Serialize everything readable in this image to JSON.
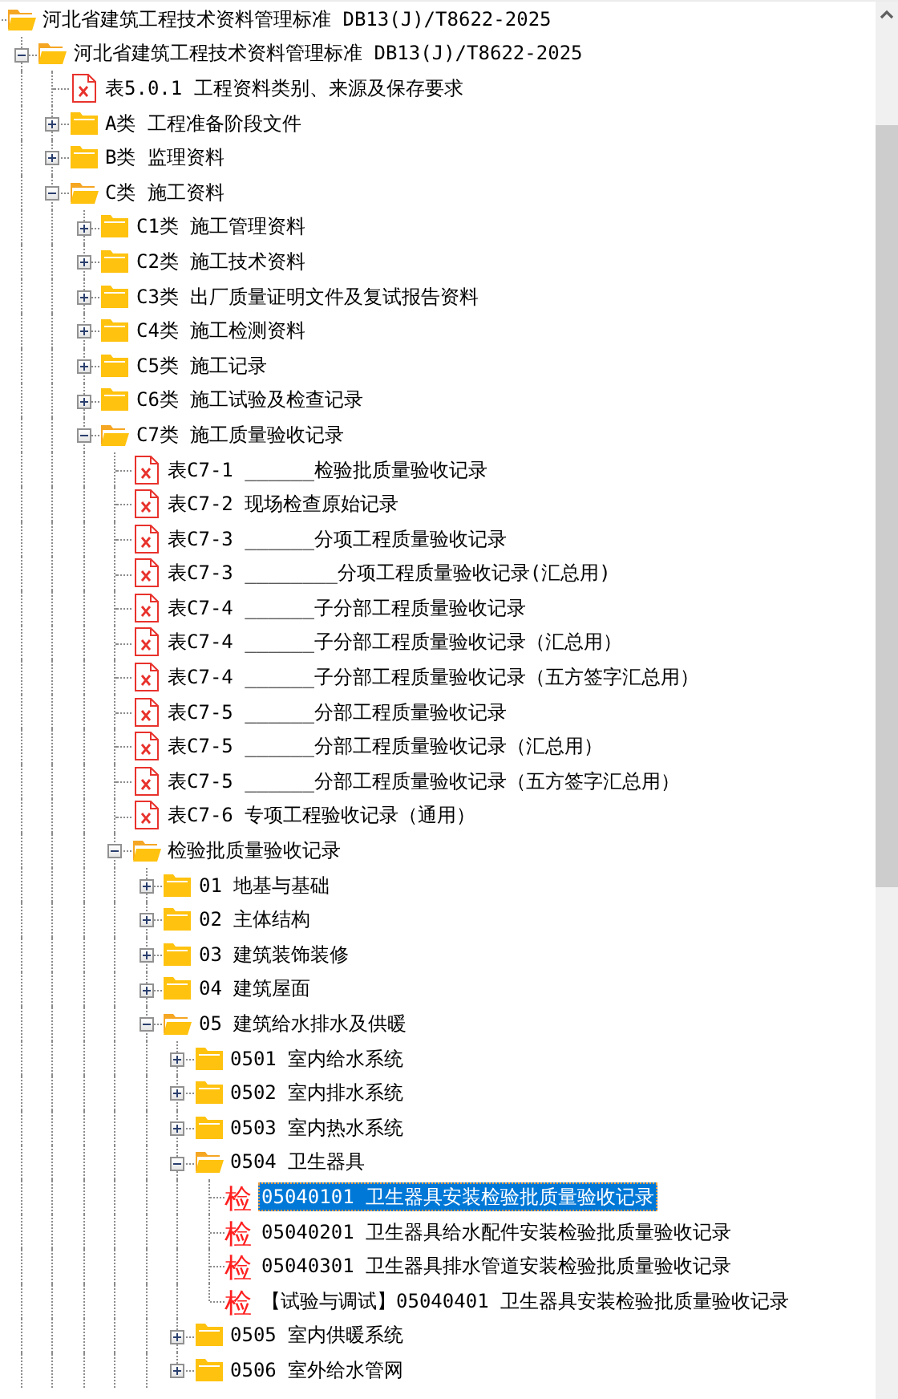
{
  "tree": {
    "label": "河北省建筑工程技术资料管理标准 DB13(J)/T8622-2025",
    "kind": "folder",
    "expanded": true,
    "selected": false,
    "children": [
      {
        "label": "河北省建筑工程技术资料管理标准 DB13(J)/T8622-2025",
        "kind": "folder",
        "expanded": true,
        "selected": false,
        "continues": true,
        "children": [
          {
            "label": "表5.0.1 工程资料类别、来源及保存要求",
            "kind": "file",
            "selected": false
          },
          {
            "label": "A类 工程准备阶段文件",
            "kind": "folder",
            "expanded": false,
            "selected": false
          },
          {
            "label": "B类 监理资料",
            "kind": "folder",
            "expanded": false,
            "selected": false
          },
          {
            "label": "C类 施工资料",
            "kind": "folder",
            "expanded": true,
            "selected": false,
            "continues": true,
            "children": [
              {
                "label": "C1类 施工管理资料",
                "kind": "folder",
                "expanded": false,
                "selected": false
              },
              {
                "label": "C2类 施工技术资料",
                "kind": "folder",
                "expanded": false,
                "selected": false
              },
              {
                "label": "C3类 出厂质量证明文件及复试报告资料",
                "kind": "folder",
                "expanded": false,
                "selected": false
              },
              {
                "label": "C4类 施工检测资料",
                "kind": "folder",
                "expanded": false,
                "selected": false
              },
              {
                "label": "C5类 施工记录",
                "kind": "folder",
                "expanded": false,
                "selected": false
              },
              {
                "label": "C6类 施工试验及检查记录",
                "kind": "folder",
                "expanded": false,
                "selected": false
              },
              {
                "label": "C7类 施工质量验收记录",
                "kind": "folder",
                "expanded": true,
                "selected": false,
                "continues": true,
                "children": [
                  {
                    "label": "表C7-1 ______检验批质量验收记录",
                    "kind": "file",
                    "selected": false
                  },
                  {
                    "label": "表C7-2 现场检查原始记录",
                    "kind": "file",
                    "selected": false
                  },
                  {
                    "label": "表C7-3 ______分项工程质量验收记录",
                    "kind": "file",
                    "selected": false
                  },
                  {
                    "label": "表C7-3 ________分项工程质量验收记录(汇总用)",
                    "kind": "file",
                    "selected": false
                  },
                  {
                    "label": "表C7-4 ______子分部工程质量验收记录",
                    "kind": "file",
                    "selected": false
                  },
                  {
                    "label": "表C7-4 ______子分部工程质量验收记录（汇总用）",
                    "kind": "file",
                    "selected": false
                  },
                  {
                    "label": "表C7-4 ______子分部工程质量验收记录（五方签字汇总用）",
                    "kind": "file",
                    "selected": false
                  },
                  {
                    "label": "表C7-5 ______分部工程质量验收记录",
                    "kind": "file",
                    "selected": false
                  },
                  {
                    "label": "表C7-5 ______分部工程质量验收记录（汇总用）",
                    "kind": "file",
                    "selected": false
                  },
                  {
                    "label": "表C7-5 ______分部工程质量验收记录（五方签字汇总用）",
                    "kind": "file",
                    "selected": false
                  },
                  {
                    "label": "表C7-6 专项工程验收记录（通用）",
                    "kind": "file",
                    "selected": false
                  },
                  {
                    "label": "检验批质量验收记录",
                    "kind": "folder",
                    "expanded": true,
                    "selected": false,
                    "continues": true,
                    "children": [
                      {
                        "label": "01 地基与基础",
                        "kind": "folder",
                        "expanded": false,
                        "selected": false
                      },
                      {
                        "label": "02 主体结构",
                        "kind": "folder",
                        "expanded": false,
                        "selected": false
                      },
                      {
                        "label": "03 建筑装饰装修",
                        "kind": "folder",
                        "expanded": false,
                        "selected": false
                      },
                      {
                        "label": "04 建筑屋面",
                        "kind": "folder",
                        "expanded": false,
                        "selected": false
                      },
                      {
                        "label": "05 建筑给水排水及供暖",
                        "kind": "folder",
                        "expanded": true,
                        "selected": false,
                        "continues": true,
                        "children": [
                          {
                            "label": "0501 室内给水系统",
                            "kind": "folder",
                            "expanded": false,
                            "selected": false
                          },
                          {
                            "label": "0502 室内排水系统",
                            "kind": "folder",
                            "expanded": false,
                            "selected": false
                          },
                          {
                            "label": "0503 室内热水系统",
                            "kind": "folder",
                            "expanded": false,
                            "selected": false
                          },
                          {
                            "label": "0504 卫生器具",
                            "kind": "folder",
                            "expanded": true,
                            "selected": false,
                            "children": [
                              {
                                "label": "05040101 卫生器具安装检验批质量验收记录",
                                "kind": "check",
                                "icon": "检",
                                "selected": true
                              },
                              {
                                "label": "05040201 卫生器具给水配件安装检验批质量验收记录",
                                "kind": "check",
                                "icon": "检",
                                "selected": false
                              },
                              {
                                "label": "05040301 卫生器具排水管道安装检验批质量验收记录",
                                "kind": "check",
                                "icon": "检",
                                "selected": false
                              },
                              {
                                "label": "【试验与调试】05040401 卫生器具安装检验批质量验收记录",
                                "kind": "check",
                                "icon": "检",
                                "selected": false
                              }
                            ]
                          },
                          {
                            "label": "0505 室内供暖系统",
                            "kind": "folder",
                            "expanded": false,
                            "selected": false
                          },
                          {
                            "label": "0506 室外给水管网",
                            "kind": "folder",
                            "expanded": false,
                            "selected": false
                          }
                        ]
                      }
                    ]
                  }
                ]
              }
            ]
          }
        ]
      }
    ]
  }
}
